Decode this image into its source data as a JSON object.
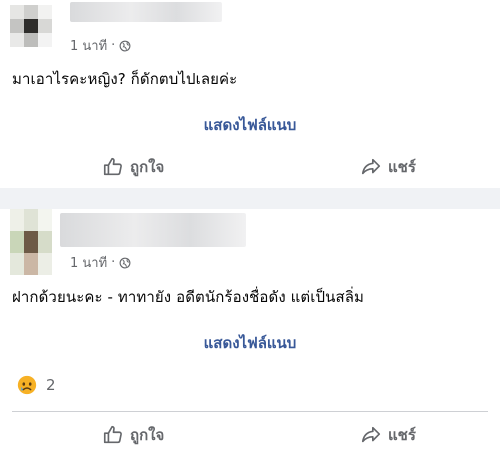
{
  "posts": [
    {
      "time": "1 นาที",
      "separator": "·",
      "text": "มาเอาไรคะหญิง? ก็ดักตบไปเลยค่ะ",
      "show_attachment": "แสดงไฟล์แนบ",
      "like_label": "ถูกใจ",
      "share_label": "แชร์"
    },
    {
      "time": "1 นาที",
      "separator": "·",
      "text": "ฝากด้วยนะคะ - ทาทายัง อดีตนักร้องชื่อดัง แต่เป็นสลิ่ม",
      "show_attachment": "แสดงไฟล์แนบ",
      "reaction_count": "2",
      "like_label": "ถูกใจ",
      "share_label": "แชร์"
    }
  ],
  "icons": {
    "globe": "globe-icon",
    "like": "thumbs-up-icon",
    "share": "share-arrow-icon",
    "reaction": "sad-face-icon"
  },
  "colors": {
    "link": "#385898",
    "secondary_text": "#65676b",
    "background": "#f0f2f5"
  }
}
